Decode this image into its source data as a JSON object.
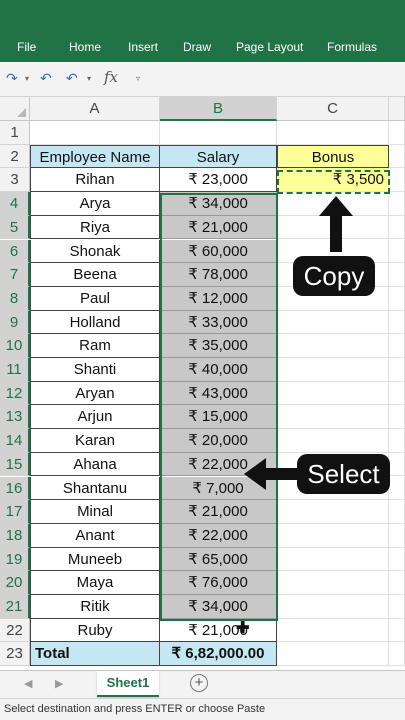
{
  "ribbon": {
    "tabs": [
      "File",
      "Home",
      "Insert",
      "Draw",
      "Page Layout",
      "Formulas"
    ],
    "color": "#217346"
  },
  "quick_access": {
    "undo_icon": "undo-icon",
    "redo_icon": "redo-icon",
    "fx_label": "fx",
    "dropdown": "▾"
  },
  "columns": [
    "A",
    "B",
    "C"
  ],
  "rows": [
    "1",
    "2",
    "3",
    "4",
    "5",
    "6",
    "7",
    "8",
    "9",
    "10",
    "11",
    "12",
    "13",
    "14",
    "15",
    "16",
    "17",
    "18",
    "19",
    "20",
    "21",
    "22",
    "23"
  ],
  "table": {
    "header": {
      "name": "Employee Name",
      "salary": "Salary",
      "bonus": "Bonus"
    },
    "employees": [
      {
        "name": "Rihan",
        "salary": "₹ 23,000"
      },
      {
        "name": "Arya",
        "salary": "₹ 34,000"
      },
      {
        "name": "Riya",
        "salary": "₹ 21,000"
      },
      {
        "name": "Shonak",
        "salary": "₹ 60,000"
      },
      {
        "name": "Beena",
        "salary": "₹ 78,000"
      },
      {
        "name": "Paul",
        "salary": "₹ 12,000"
      },
      {
        "name": "Holland",
        "salary": "₹ 33,000"
      },
      {
        "name": "Ram",
        "salary": "₹ 35,000"
      },
      {
        "name": "Shanti",
        "salary": "₹ 40,000"
      },
      {
        "name": "Aryan",
        "salary": "₹ 43,000"
      },
      {
        "name": "Arjun",
        "salary": "₹ 15,000"
      },
      {
        "name": "Karan",
        "salary": "₹ 20,000"
      },
      {
        "name": "Ahana",
        "salary": "₹ 22,000"
      },
      {
        "name": "Shantanu",
        "salary": "₹ 7,000"
      },
      {
        "name": "Minal",
        "salary": "₹ 21,000"
      },
      {
        "name": "Anant",
        "salary": "₹ 22,000"
      },
      {
        "name": "Muneeb",
        "salary": "₹ 65,000"
      },
      {
        "name": "Maya",
        "salary": "₹ 76,000"
      },
      {
        "name": "Ritik",
        "salary": "₹ 34,000"
      },
      {
        "name": "Ruby",
        "salary": "₹ 21,000"
      }
    ],
    "bonus_value": "₹ 3,500",
    "total_label": "Total",
    "total_value": "₹ 6,82,000.00"
  },
  "annotations": {
    "copy": "Copy",
    "select": "Select"
  },
  "sheet_tabs": {
    "active": "Sheet1",
    "add": "+"
  },
  "status_bar": {
    "message": "Select destination and press ENTER or choose Paste"
  },
  "colors": {
    "header_blue": "#c5e7f3",
    "bonus_yellow": "#ffff99",
    "selection_gray": "#c8c8c8",
    "excel_green": "#217346"
  }
}
